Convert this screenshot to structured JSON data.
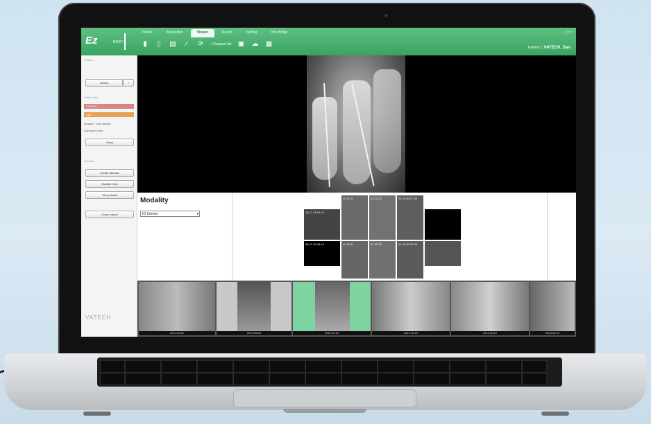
{
  "app": {
    "logo": "Ez",
    "logo_sub": "DENT-i",
    "tabs": [
      "Patient",
      "Acquisition",
      "Viewer",
      "Report",
      "Setting",
      "Info Bridge"
    ],
    "active_tab_index": 2,
    "toolbar_label": "+ Request list",
    "user_label": "Patient 1:",
    "user_name": "VATECH, Dan",
    "window_controls": "_ □ ×"
  },
  "sidebar": {
    "section1": "Search",
    "search_button": "Search",
    "section2": "Patient Info",
    "bar1": "VATECH",
    "bar2": "Dan",
    "info1": "Images / Total images",
    "info2": "Exposure  Dose",
    "show_button": "Show",
    "section3": "Worklist",
    "buttons": [
      "Create Worklist",
      "Worklist View",
      "Show Detail",
      "Close Layout"
    ],
    "brand": "VATECH"
  },
  "modality": {
    "title": "Modality",
    "selected": "IO Sensor"
  },
  "fmx_labels": [
    "18 17 16 15 14",
    "13 12 11",
    "21 22 23",
    "24 25 26 27 28",
    "48 47 46 45 44",
    "43 42 41",
    "31 32 33",
    "34 35 36 37 38"
  ],
  "strip_captions": [
    "2014.05.12",
    "2014.05.12",
    "2014.05.12",
    "2014.05.12",
    "2014.05.12",
    "2014.05.12"
  ],
  "colors": {
    "accent": "#3aa362",
    "bar1": "#d98585",
    "bar2": "#e8a055"
  }
}
